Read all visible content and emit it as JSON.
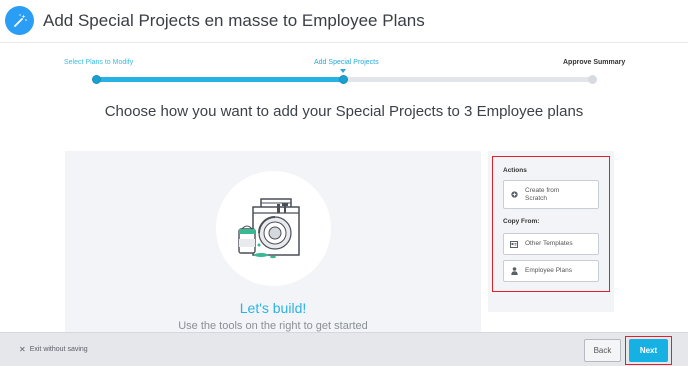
{
  "header": {
    "title": "Add Special Projects en masse to Employee Plans",
    "icon": "magic-wand-icon",
    "icon_color": "#2a9df4"
  },
  "stepper": {
    "steps": [
      {
        "label": "Select Plans to Modify",
        "state": "done"
      },
      {
        "label": "Add Special Projects",
        "state": "active"
      },
      {
        "label": "Approve Summary",
        "state": "upcoming"
      }
    ],
    "accent_color": "#26b3e3"
  },
  "main": {
    "subtitle": "Choose how you want to add your Special Projects to 3 Employee plans",
    "build_panel": {
      "heading": "Let's build!",
      "hint": "Use the tools on the right to get started"
    }
  },
  "actions": {
    "title": "Actions",
    "create_label": "Create from Scratch",
    "create_icon": "plus-circle-icon",
    "copy_from_title": "Copy From:",
    "other_templates_label": "Other Templates",
    "other_templates_icon": "templates-icon",
    "employee_plans_label": "Employee Plans",
    "employee_plans_icon": "person-icon"
  },
  "footer": {
    "exit_label": "Exit without saving",
    "back_label": "Back",
    "next_label": "Next"
  }
}
